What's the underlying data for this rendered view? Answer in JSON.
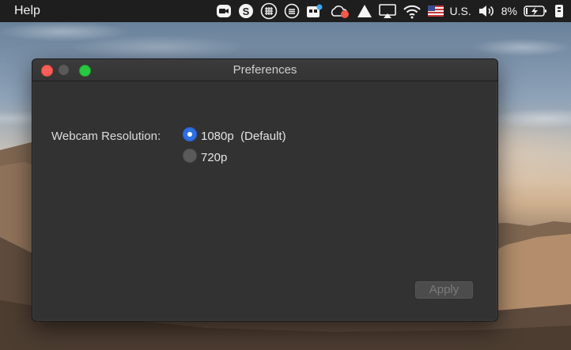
{
  "menubar": {
    "app_menu_item": "Help",
    "keyboard_layout": "U.S.",
    "battery_percent": "8%"
  },
  "window": {
    "title": "Preferences",
    "webcam_label": "Webcam Resolution:",
    "options": [
      {
        "label": "1080p",
        "note": "(Default)",
        "selected": true
      },
      {
        "label": "720p",
        "note": "",
        "selected": false
      }
    ],
    "apply_label": "Apply"
  },
  "icons": [
    "zoom-icon",
    "skype-icon",
    "grid-icon",
    "menu-circle-icon",
    "notification-app-icon",
    "cloud-sync-icon",
    "triangle-icon",
    "airplay-icon",
    "wifi-icon",
    "us-flag-icon",
    "volume-icon",
    "battery-charging-icon",
    "control-center-icon"
  ],
  "colors": {
    "menubar": "#1e1e1f",
    "window_bg": "#333233",
    "radio_selected": "#2f6fe4",
    "close": "#fc5f57",
    "maximize": "#28c841"
  }
}
